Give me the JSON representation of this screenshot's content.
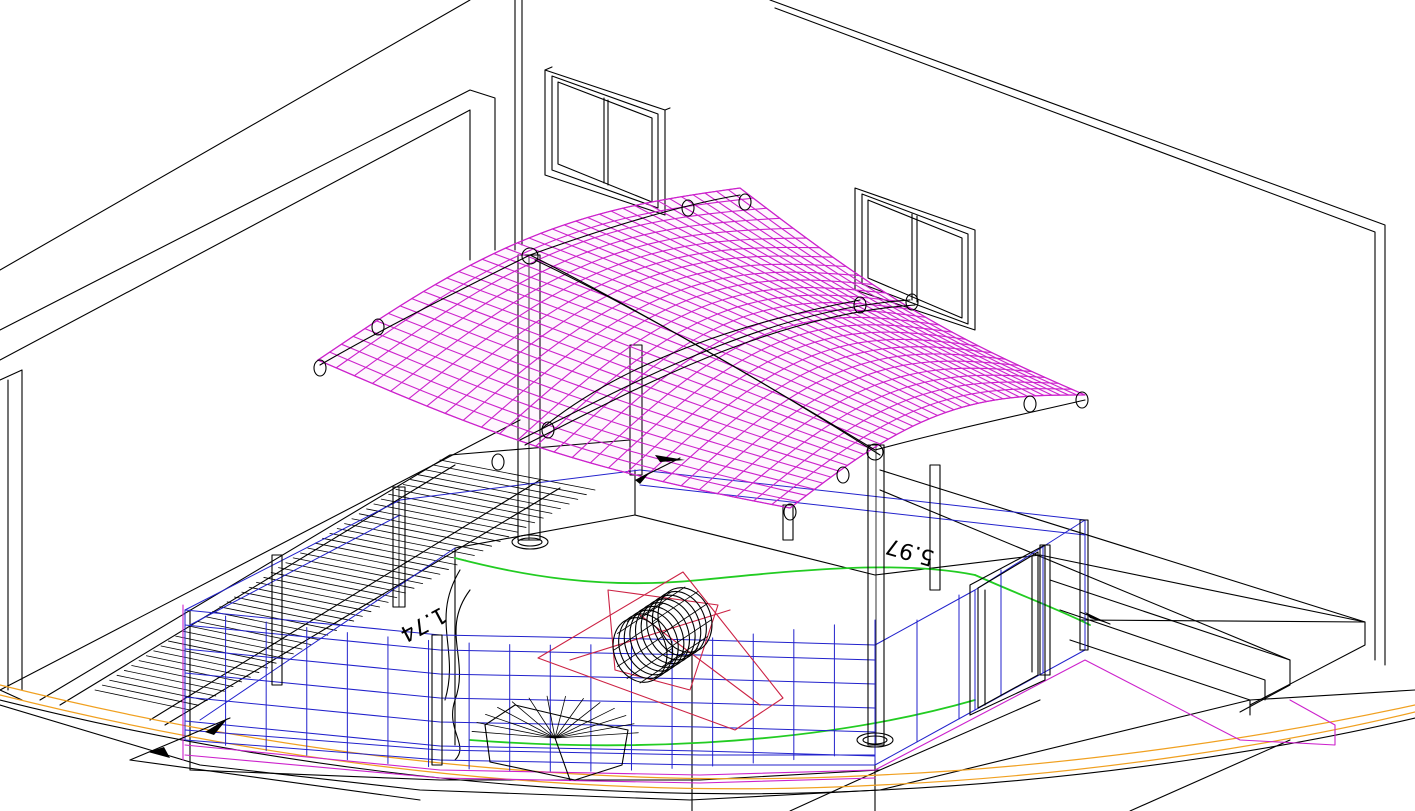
{
  "dimensions": {
    "width_label": "5.97",
    "depth_label": "1.74"
  },
  "colors": {
    "background": "#ffffff",
    "linework": "#000000",
    "roof_canopy": "#cc22cc",
    "railing": "#2222cc",
    "garden_path": "#22cc22",
    "feature_base": "#cc2244",
    "site_boundary": "#f0a020"
  }
}
